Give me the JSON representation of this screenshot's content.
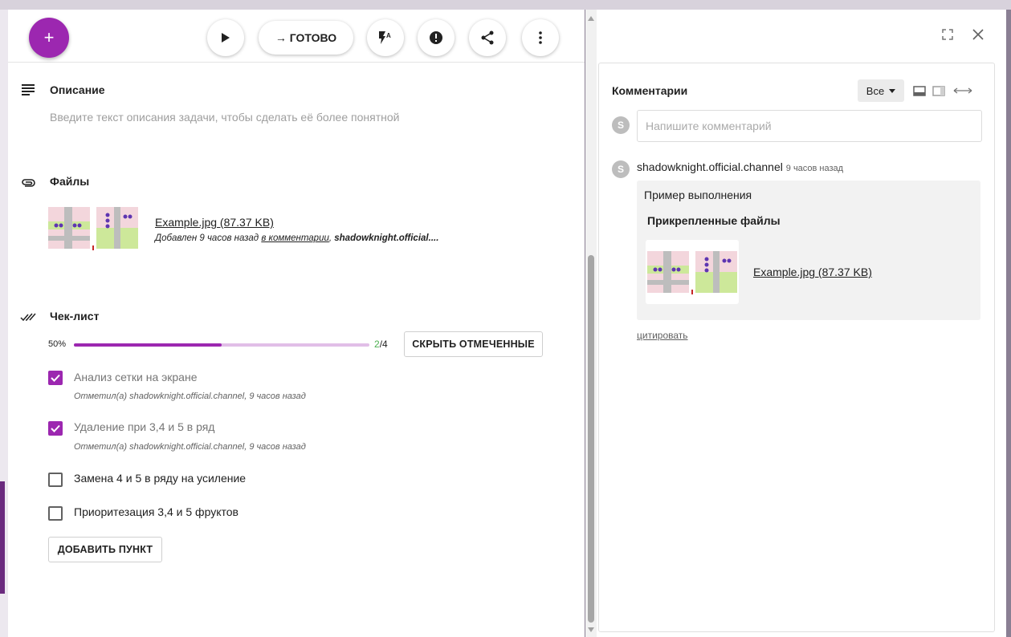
{
  "toolbar": {
    "add_icon": "plus-icon",
    "done_label": "→ ГОТОВО",
    "icons": [
      "play-icon",
      "flash-auto-icon",
      "alert-icon",
      "share-icon",
      "more-vertical-icon"
    ]
  },
  "description": {
    "title": "Описание",
    "placeholder": "Введите текст описания задачи, чтобы сделать её более понятной"
  },
  "files": {
    "title": "Файлы",
    "file_name": "Example.jpg (87.37 KB)",
    "meta_prefix": "Добавлен 9 часов назад ",
    "meta_link": "в комментарии",
    "meta_sep": ", ",
    "meta_author": "shadowknight.official...."
  },
  "checklist": {
    "title": "Чек-лист",
    "progress_label": "50%",
    "progress_fraction": 0.5,
    "done_count": "2",
    "total_label": "/4",
    "hide_checked_label": "СКРЫТЬ ОТМЕЧЕННЫЕ",
    "add_item_label": "ДОБАВИТЬ ПУНКТ",
    "items": [
      {
        "text": "Анализ сетки на экране",
        "checked": true,
        "meta": "Отметил(а) shadowknight.official.channel, 9 часов назад"
      },
      {
        "text": "Удаление при 3,4 и 5 в ряд",
        "checked": true,
        "meta": "Отметил(а) shadowknight.official.channel, 9 часов назад"
      },
      {
        "text": "Замена 4 и 5 в ряду на усиление",
        "checked": false,
        "meta": ""
      },
      {
        "text": "Приоритезация 3,4 и 5 фруктов",
        "checked": false,
        "meta": ""
      }
    ]
  },
  "comments": {
    "title": "Комментарии",
    "filter_label": "Все",
    "input_placeholder": "Напишите комментарий",
    "avatar_letter": "S",
    "author": "shadowknight.official.channel",
    "time": "9 часов назад",
    "text": "Пример выполнения",
    "attached_title": "Прикрепленные файлы",
    "attached_file": "Example.jpg (87.37 KB)",
    "quote_label": "цитировать"
  },
  "colors": {
    "accent": "#9c27b0",
    "accent_light": "#e1bee7",
    "count_green": "#4caf50"
  }
}
